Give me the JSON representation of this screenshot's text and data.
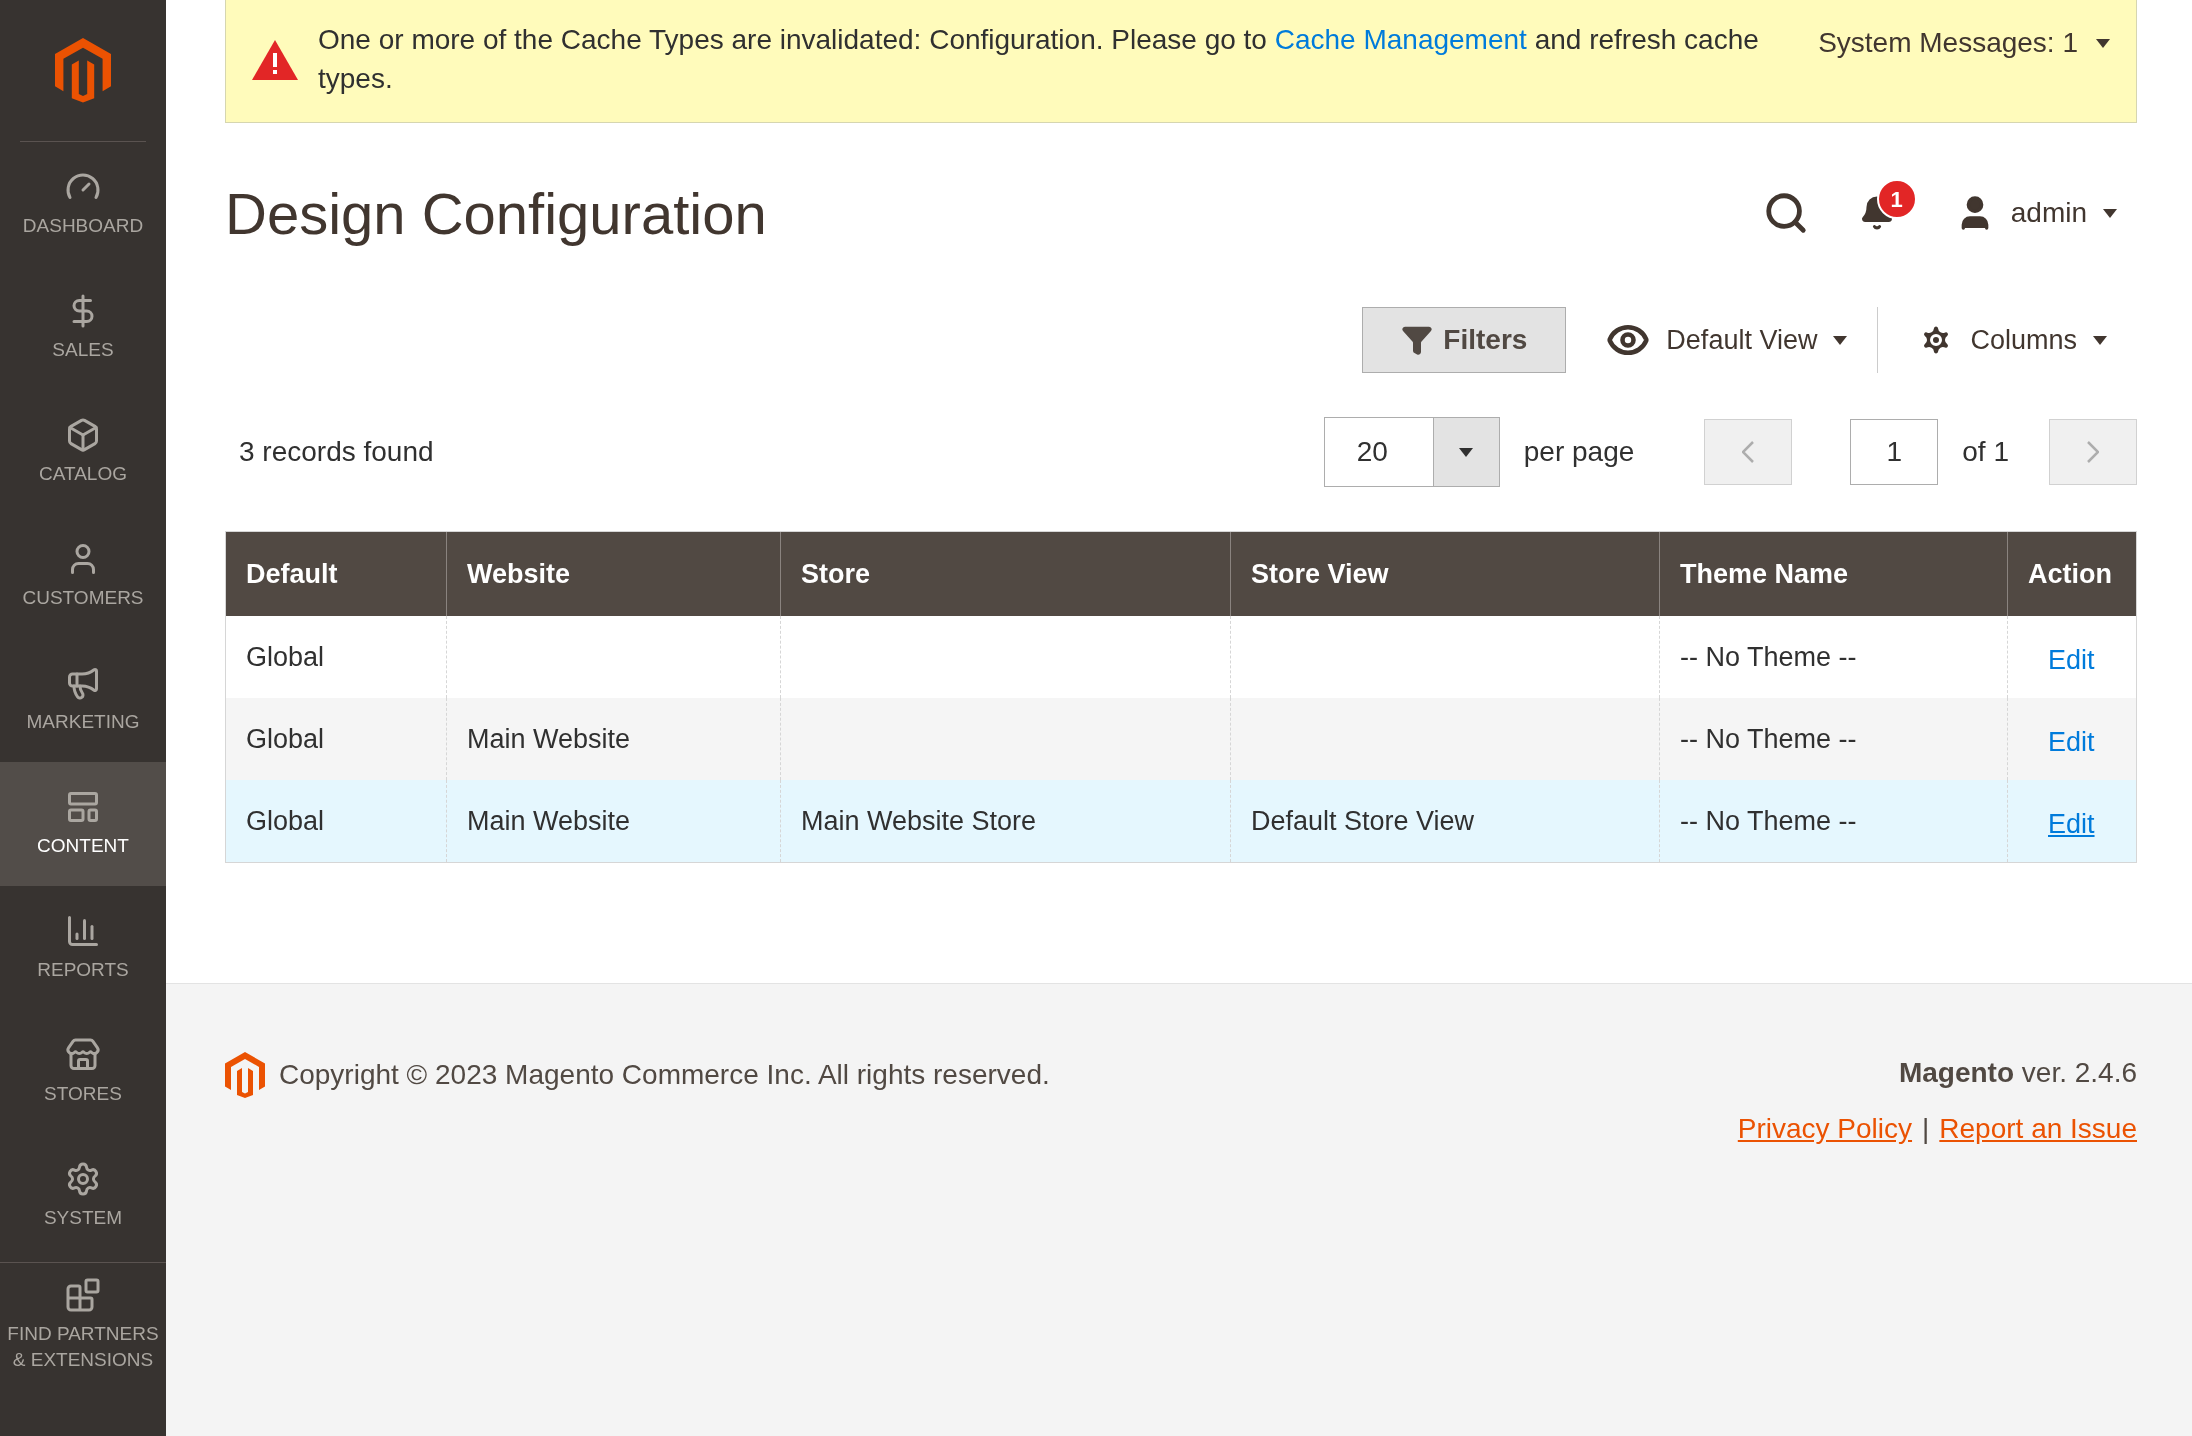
{
  "sidebar": {
    "items": [
      {
        "kind": "dashboard",
        "label": "DASHBOARD",
        "selected": false
      },
      {
        "kind": "sales",
        "label": "SALES",
        "selected": false
      },
      {
        "kind": "catalog",
        "label": "CATALOG",
        "selected": false
      },
      {
        "kind": "customers",
        "label": "CUSTOMERS",
        "selected": false
      },
      {
        "kind": "marketing",
        "label": "MARKETING",
        "selected": false
      },
      {
        "kind": "content",
        "label": "CONTENT",
        "selected": true
      },
      {
        "kind": "reports",
        "label": "REPORTS",
        "selected": false
      },
      {
        "kind": "stores",
        "label": "STORES",
        "selected": false
      },
      {
        "kind": "system",
        "label": "SYSTEM",
        "selected": false
      },
      {
        "kind": "partners",
        "label": "FIND PARTNERS & EXTENSIONS",
        "selected": false
      }
    ]
  },
  "notice": {
    "text_before": "One or more of the Cache Types are invalidated: Configuration. Please go to",
    "link": "Cache Management",
    "text_after": "and refresh cache types.",
    "system_messages": "System Messages: 1"
  },
  "header": {
    "title": "Design Configuration",
    "notification_count": "1",
    "user": "admin"
  },
  "toolbar": {
    "filters": "Filters",
    "view": "Default View",
    "columns": "Columns"
  },
  "pagination": {
    "records": "3 records found",
    "per_page_value": "20",
    "per_page_label": "per page",
    "page": "1",
    "of": "of 1"
  },
  "table": {
    "columns": [
      "Default",
      "Website",
      "Store",
      "Store View",
      "Theme Name",
      "Action"
    ],
    "rows": [
      {
        "cells": [
          "Global",
          "",
          "",
          "",
          "-- No Theme --"
        ],
        "action": "Edit",
        "selected": false
      },
      {
        "cells": [
          "Global",
          "Main Website",
          "",
          "",
          "-- No Theme --"
        ],
        "action": "Edit",
        "selected": false
      },
      {
        "cells": [
          "Global",
          "Main Website",
          "Main Website Store",
          "Default Store View",
          "-- No Theme --"
        ],
        "action": "Edit",
        "selected": true
      }
    ]
  },
  "footer": {
    "copyright": "Copyright © 2023 Magento Commerce Inc. All rights reserved.",
    "version": "**Magento** ver. 2.4.6",
    "links": [
      "Privacy Policy",
      "Report an Issue"
    ],
    "separator": "|"
  }
}
